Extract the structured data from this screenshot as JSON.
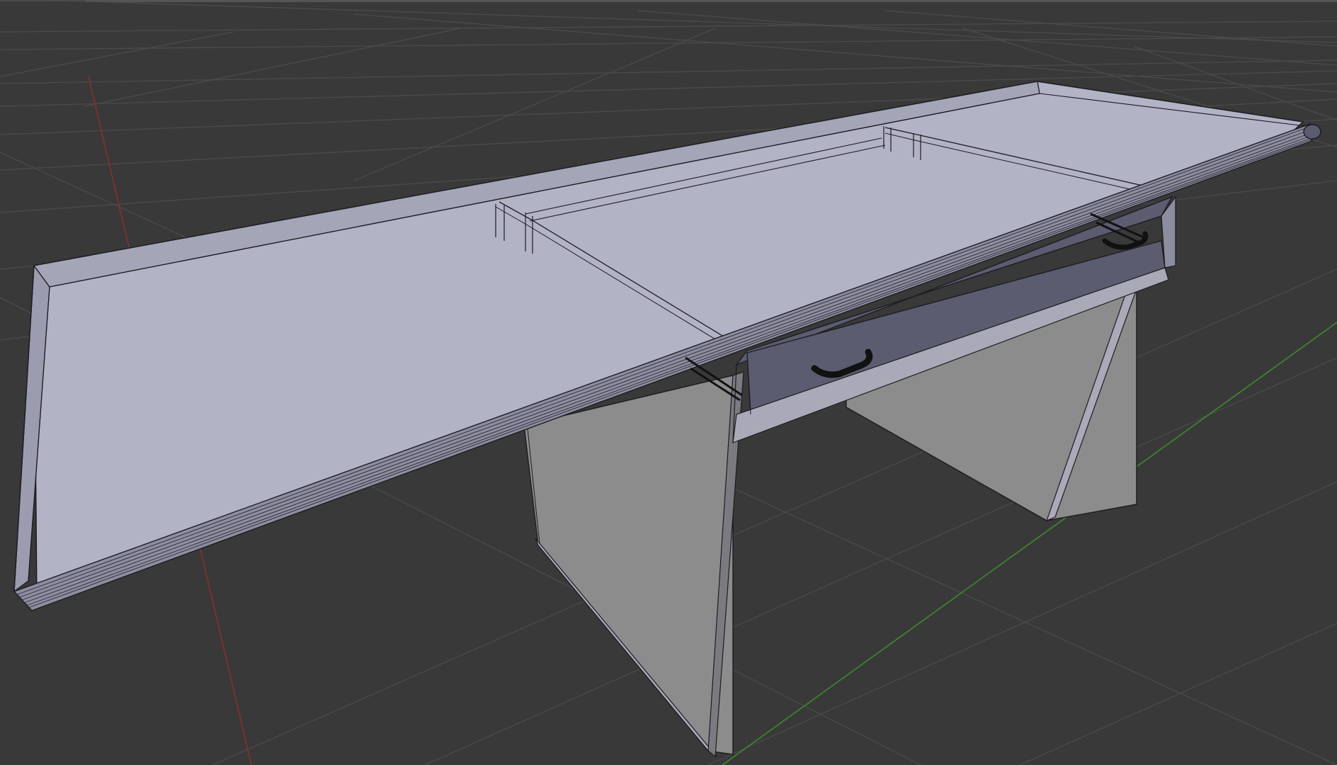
{
  "viewport": {
    "mode": "3d-view",
    "shading": "solid-with-wireframe",
    "background_color": "#393939",
    "grid_color": "#4b4b4b",
    "x_axis_color": "#8a2f2f",
    "y_axis_color": "#3d8a2e"
  },
  "scene_object": {
    "name": "desk-model",
    "parts": [
      "tabletop",
      "front-rounded-edge",
      "left-leg-panel",
      "right-leg-panel",
      "drawer",
      "drawer-handle",
      "rail-brackets"
    ],
    "colors": {
      "top_surface": "#b3b3c6",
      "side_surface": "#9c9cb0",
      "leg_surface": "#8c8c8c",
      "leg_edge": "#a9a9b7",
      "drawer_face": "#5c5c70",
      "wire": "#1c1c22",
      "handle": "#111111"
    }
  }
}
